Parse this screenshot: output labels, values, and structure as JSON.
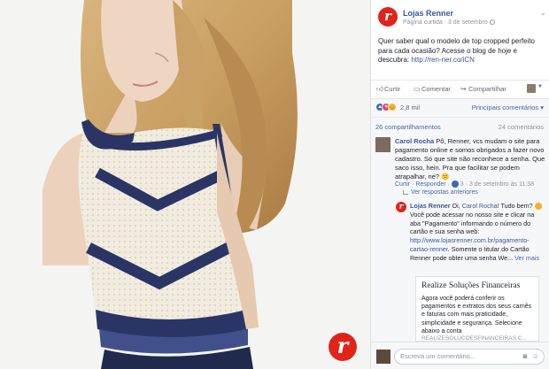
{
  "post": {
    "page_name": "Lojas Renner",
    "page_meta": "Página curtida · 3 de setembro",
    "text_main": "Quer saber qual o modelo de top cropped perfeito para cada ocasião? Acesse o blog de hoje e descubra: ",
    "text_link": "http://ren-ner.co/iCN",
    "logo_letter": "r"
  },
  "actions": {
    "like": "Curtir",
    "comment": "Comentar",
    "share": "Compartilhar"
  },
  "reactions": {
    "count": "2,8 mil",
    "filter": "Principais comentários ▾"
  },
  "counts": {
    "shares": "26 compartilhamentos",
    "comments": "24 comentários"
  },
  "comment1": {
    "author": "Carol Rocha",
    "text": " Pô, Renner, vcs mudam o site para pagamento online e somos obrigados a fazer novo cadastro. Só que site não reconhece a senha. Que saco isso, hein. Pra que facilitar se podem atrapalhar, né? 😕",
    "like_label": "Curtir",
    "reply_label": "Responder",
    "reactions": "3",
    "time": "3 de setembro às 11:38",
    "previous_replies": "Ver respostas anteriores"
  },
  "reply1": {
    "author": "Lojas Renner",
    "greeting": " Oi, ",
    "tagged": "Carol Rocha",
    "greeting_end": "! Tudo bem? ",
    "text1": "Você pode acessar no nosso site e clicar na aba \"Pagamento\" informando o número do cartão e sua senha web: ",
    "link": "http://www.lojasrenner.com.br/pagamento-cartao-renner",
    "text2": ". Somente o titular do Cartão Renner pode obter uma senha We...",
    "see_more": "Ver mais"
  },
  "link_preview": {
    "title": "Realize Soluções Financeiras",
    "description": "Agora você poderá conferir os pagamentos e extratos dos seus carnês e faturas com mais praticidade, simplicidade e segurança. Selecione abaixo a conta",
    "domain": "REALIZESOLUCOESFINANCEIRAS.C..."
  },
  "composer": {
    "placeholder": "Escreva um comentário..."
  },
  "icons": {
    "like": "thumbs-up-icon",
    "comment": "speech-bubble-icon",
    "share": "share-arrow-icon",
    "camera": "camera-icon",
    "emoji": "smiley-icon"
  },
  "colors": {
    "brand_red": "#e2231a",
    "link_blue": "#365899",
    "top_navy": "#2a3566",
    "top_cream": "#f3eee2"
  }
}
